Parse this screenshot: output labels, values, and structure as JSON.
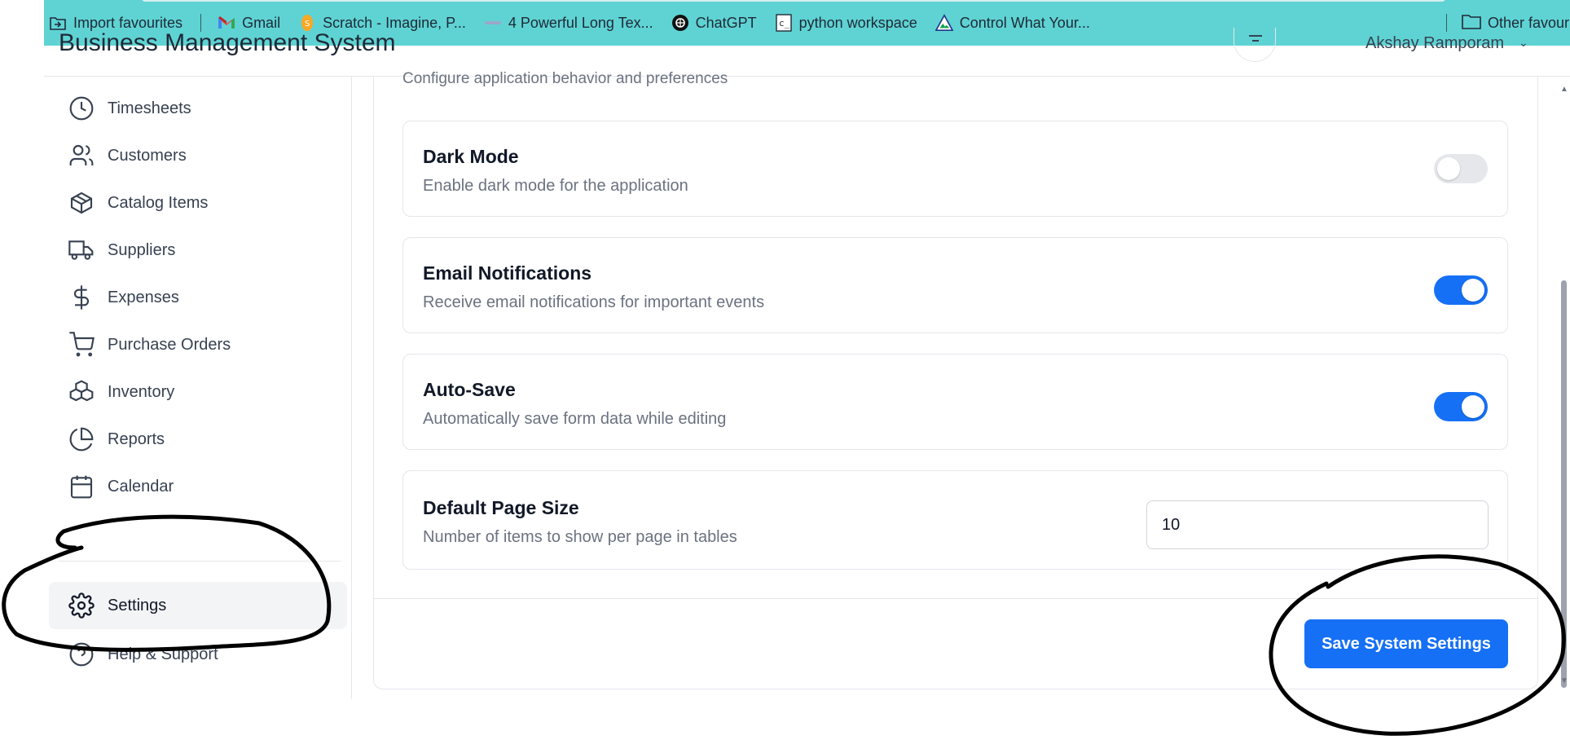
{
  "bookmarks": {
    "items": [
      {
        "label": "Import favourites",
        "icon": "import-icon"
      },
      {
        "label": "Gmail",
        "icon": "gmail-icon"
      },
      {
        "label": "Scratch - Imagine, P...",
        "icon": "scratch-icon"
      },
      {
        "label": "4 Powerful Long Tex...",
        "icon": "site-icon"
      },
      {
        "label": "ChatGPT",
        "icon": "chatgpt-icon"
      },
      {
        "label": "python workspace",
        "icon": "python-workspace-icon"
      },
      {
        "label": "Control What Your...",
        "icon": "mountain-icon"
      }
    ],
    "other": "Other favourit"
  },
  "header": {
    "title": "Business Management System",
    "user_name": "Akshay Ramporam"
  },
  "sidebar": {
    "items": [
      {
        "label": "Timesheets",
        "icon": "clock-icon"
      },
      {
        "label": "Customers",
        "icon": "users-icon"
      },
      {
        "label": "Catalog Items",
        "icon": "package-icon"
      },
      {
        "label": "Suppliers",
        "icon": "truck-icon"
      },
      {
        "label": "Expenses",
        "icon": "dollar-icon"
      },
      {
        "label": "Purchase Orders",
        "icon": "cart-icon"
      },
      {
        "label": "Inventory",
        "icon": "boxes-icon"
      },
      {
        "label": "Reports",
        "icon": "pie-chart-icon"
      },
      {
        "label": "Calendar",
        "icon": "calendar-icon"
      }
    ],
    "bottom_items": [
      {
        "label": "Settings",
        "icon": "gear-icon",
        "active": true
      },
      {
        "label": "Help & Support",
        "icon": "help-icon"
      }
    ]
  },
  "main": {
    "subtitle": "Configure application behavior and preferences",
    "settings": [
      {
        "title": "Dark Mode",
        "description": "Enable dark mode for the application",
        "enabled": false
      },
      {
        "title": "Email Notifications",
        "description": "Receive email notifications for important events",
        "enabled": true
      },
      {
        "title": "Auto-Save",
        "description": "Automatically save form data while editing",
        "enabled": true
      }
    ],
    "page_size": {
      "title": "Default Page Size",
      "description": "Number of items to show per page in tables",
      "value": "10"
    },
    "save_label": "Save System Settings"
  },
  "colors": {
    "bookmarks_bg": "#5fd3d3",
    "primary": "#1670f5",
    "annotation": "#000000"
  }
}
